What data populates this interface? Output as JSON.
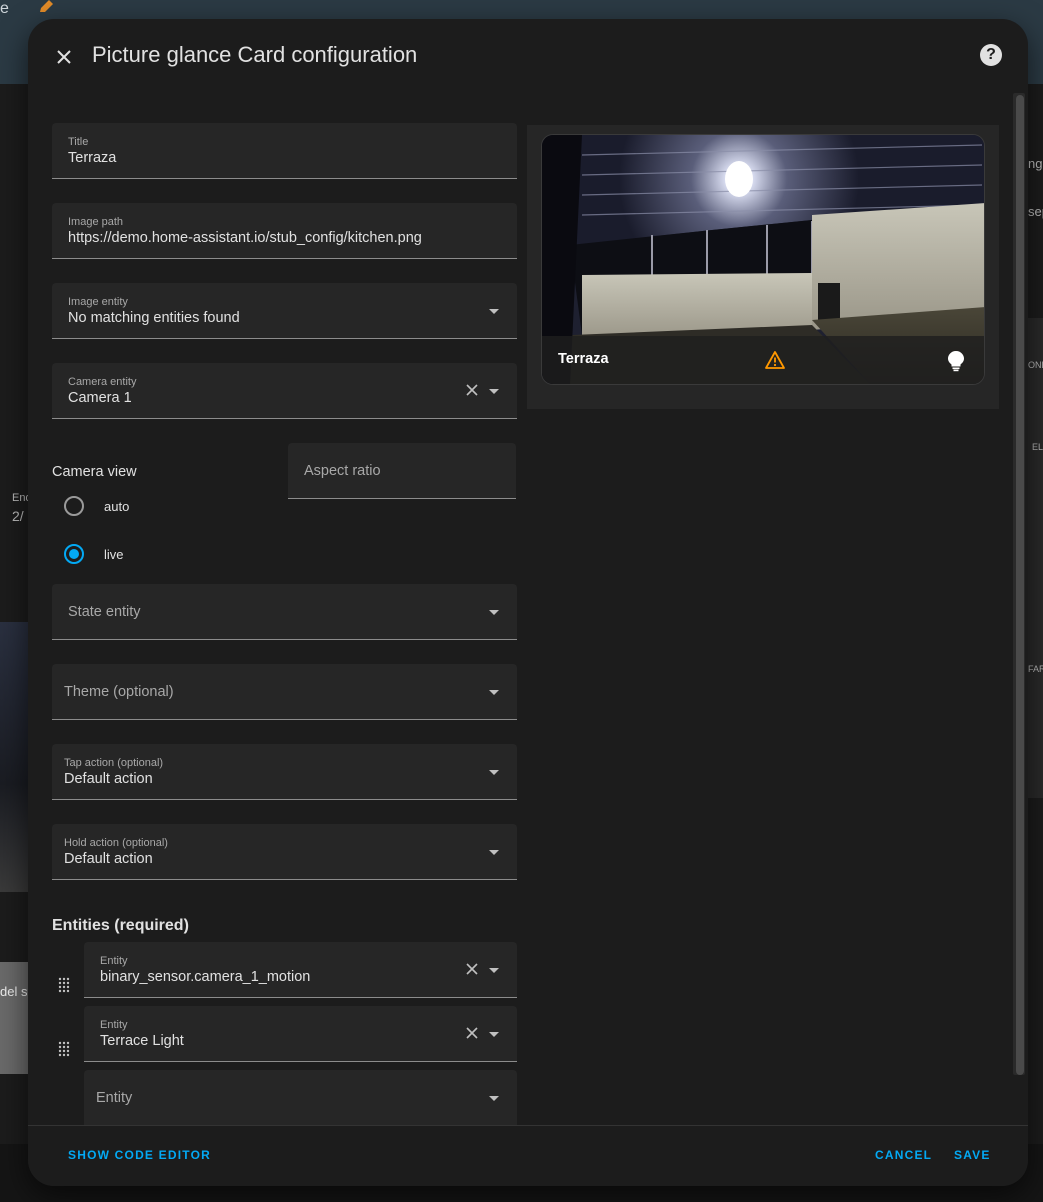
{
  "background": {
    "left_snippet_1": "e",
    "left_snippet_2": "End",
    "left_snippet_3": "2/",
    "left_snippet_4": "del s",
    "right_snippet_1": "ng",
    "right_snippet_2": "sep",
    "right_snippet_3": "ONE",
    "right_snippet_4": "EL",
    "right_snippet_5": "FAR"
  },
  "dialog": {
    "title": "Picture glance Card configuration",
    "help_glyph": "?"
  },
  "form": {
    "title": {
      "label": "Title",
      "value": "Terraza"
    },
    "image_path": {
      "label": "Image path",
      "value": "https://demo.home-assistant.io/stub_config/kitchen.png"
    },
    "image_entity": {
      "label": "Image entity",
      "value": "No matching entities found"
    },
    "camera_entity": {
      "label": "Camera entity",
      "value": "Camera 1"
    },
    "camera_view": {
      "label": "Camera view",
      "options": [
        {
          "label": "auto",
          "checked": false
        },
        {
          "label": "live",
          "checked": true
        }
      ]
    },
    "aspect_ratio": {
      "placeholder": "Aspect ratio"
    },
    "state_entity": {
      "placeholder": "State entity"
    },
    "theme": {
      "placeholder": "Theme (optional)"
    },
    "tap_action": {
      "label": "Tap action (optional)",
      "value": "Default action"
    },
    "hold_action": {
      "label": "Hold action (optional)",
      "value": "Default action"
    },
    "entities_title": "Entities (required)",
    "entities": [
      {
        "label": "Entity",
        "value": "binary_sensor.camera_1_motion"
      },
      {
        "label": "Entity",
        "value": "Terrace Light"
      }
    ],
    "new_entity": {
      "placeholder": "Entity"
    }
  },
  "preview": {
    "card_title": "Terraza",
    "icons": [
      "alert-triangle-icon",
      "lightbulb-icon"
    ],
    "warn_color": "#ff9800"
  },
  "footer": {
    "show_code_editor": "SHOW CODE EDITOR",
    "cancel": "CANCEL",
    "save": "SAVE"
  },
  "colors": {
    "accent": "#03a9f4",
    "surface": "#1c1c1c",
    "field": "#262626"
  }
}
